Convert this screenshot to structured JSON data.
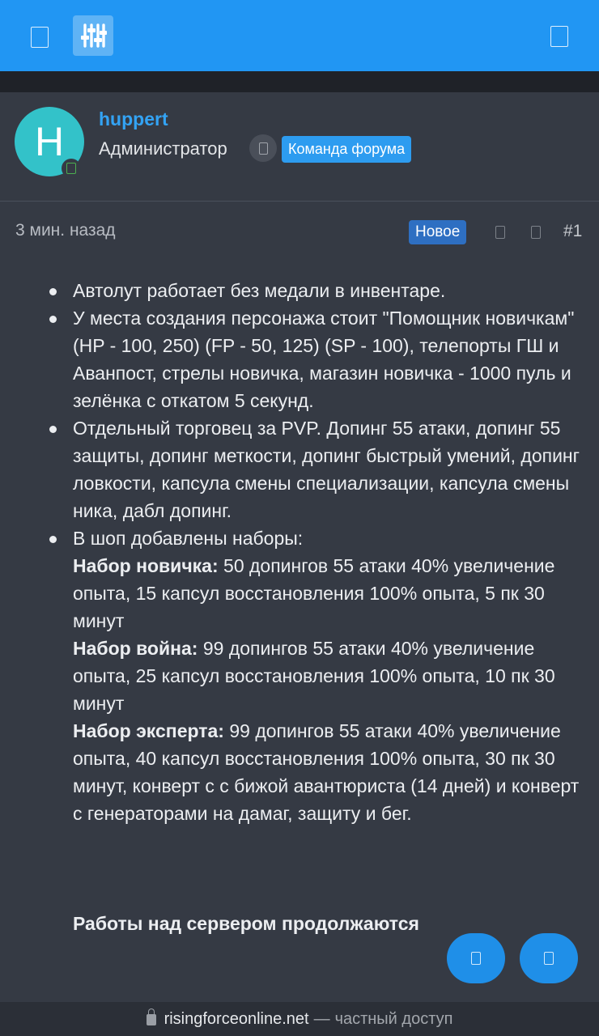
{
  "colors": {
    "topbar": "#2196f3",
    "accent": "#33a3f4",
    "badge_team": "#2d9cf0",
    "badge_new": "#2e6fc2",
    "avatar_bg": "#33c2c9",
    "background": "#353a44"
  },
  "header": {
    "menu_icon": "menu-icon",
    "logo_icon": "sliders-icon",
    "right_icon": "account-icon"
  },
  "author": {
    "avatar_letter": "H",
    "username": "huppert",
    "role": "Администратор",
    "team_badge": "Команда форума"
  },
  "post": {
    "time": "3 мин. назад",
    "new_badge": "Новое",
    "number": "#1",
    "bullets": {
      "b1": "Автолут работает без медали в инвентаре.",
      "b2": "У места создания персонажа стоит \"Помощник новичкам\" (HP - 100, 250) (FP - 50, 125) (SP - 100), телепорты ГШ и Аванпост, стрелы новичка, магазин новичка - 1000 пуль и зелёнка с откатом 5 секунд.",
      "b3": "Отдельный торговец за PVP. Допинг 55 атаки, допинг 55 защиты, допинг меткости, допинг быстрый умений, допинг ловкости, капсула смены специализации, капсула смены ника, дабл допинг.",
      "b4_intro": "В шоп добавлены наборы:",
      "set1_title": "Набор новичка:",
      "set1_text": " 50 допингов 55 атаки 40% увеличение опыта, 15 капсул восстановления 100% опыта, 5 пк 30 минут",
      "set2_title": "Набор война:",
      "set2_text": " 99 допингов 55 атаки 40% увеличение опыта, 25 капсул восстановления 100% опыта, 10 пк 30 минут",
      "set3_title": "Набор эксперта:",
      "set3_text": " 99 допингов 55 атаки 40% увеличение опыта, 40 капсул восстановления 100% опыта, 30 пк 30 минут, конверт с с бижой авантюриста (14 дней) и конверт с генераторами на дамаг, защиту и бег."
    },
    "closing": "Работы над сервером продолжаются"
  },
  "browser": {
    "domain": "risingforceonline.net",
    "separator": "—",
    "private_label": "частный доступ"
  }
}
